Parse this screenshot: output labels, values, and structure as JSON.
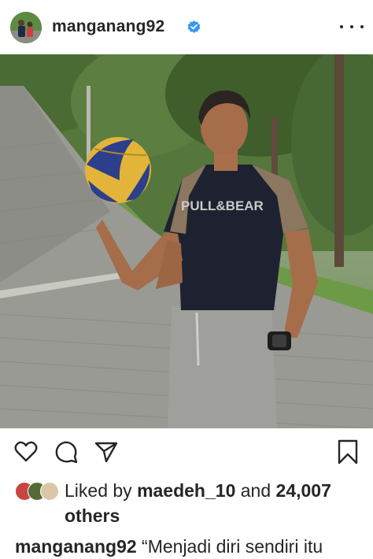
{
  "post": {
    "username": "manganang92",
    "verified": true,
    "more_icon": "more-horizontal-icon"
  },
  "actions": {
    "icons": [
      "heart-icon",
      "comment-icon",
      "share-icon",
      "bookmark-icon"
    ]
  },
  "likes": {
    "prefix": "Liked by",
    "liker": "maedeh_10",
    "connector": "and",
    "count": "24,007",
    "suffix": "others"
  },
  "caption": {
    "username": "manganang92",
    "text": "“Menjadi diri sendiri itu"
  },
  "colors": {
    "text": "#262626",
    "verified_blue": "#3897f0",
    "background": "#ffffff"
  }
}
